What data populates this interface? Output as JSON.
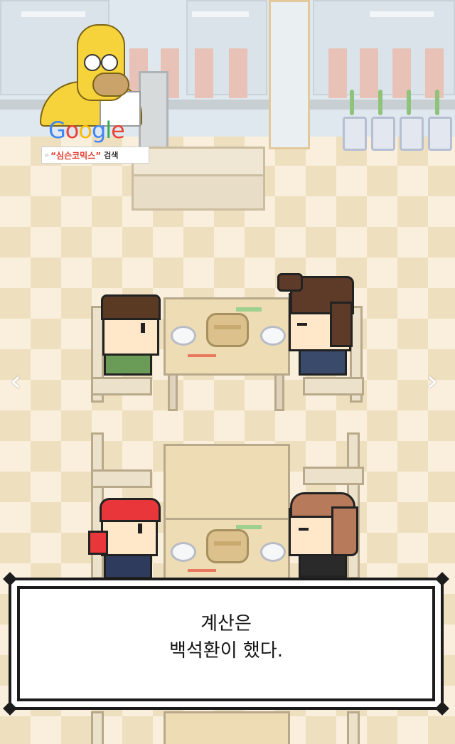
{
  "ad": {
    "brand_letters": [
      "G",
      "o",
      "o",
      "g",
      "l",
      "e"
    ],
    "brand_colors": [
      "#4285f4",
      "#ea4335",
      "#fbbc05",
      "#4285f4",
      "#34a853",
      "#ea4335"
    ],
    "search_icon": "magnifier-icon",
    "query": "“심슨코믹스”",
    "button_label": "검색"
  },
  "navigation": {
    "prev_label": "‹",
    "next_label": "›"
  },
  "dialog": {
    "line1": "계산은",
    "line2": "백석환이 했다."
  },
  "colors": {
    "floor_light": "#f9efdc",
    "floor_dark": "#eedfbf",
    "dialog_border": "#1c1c1c",
    "bandana": "#e8363b"
  }
}
